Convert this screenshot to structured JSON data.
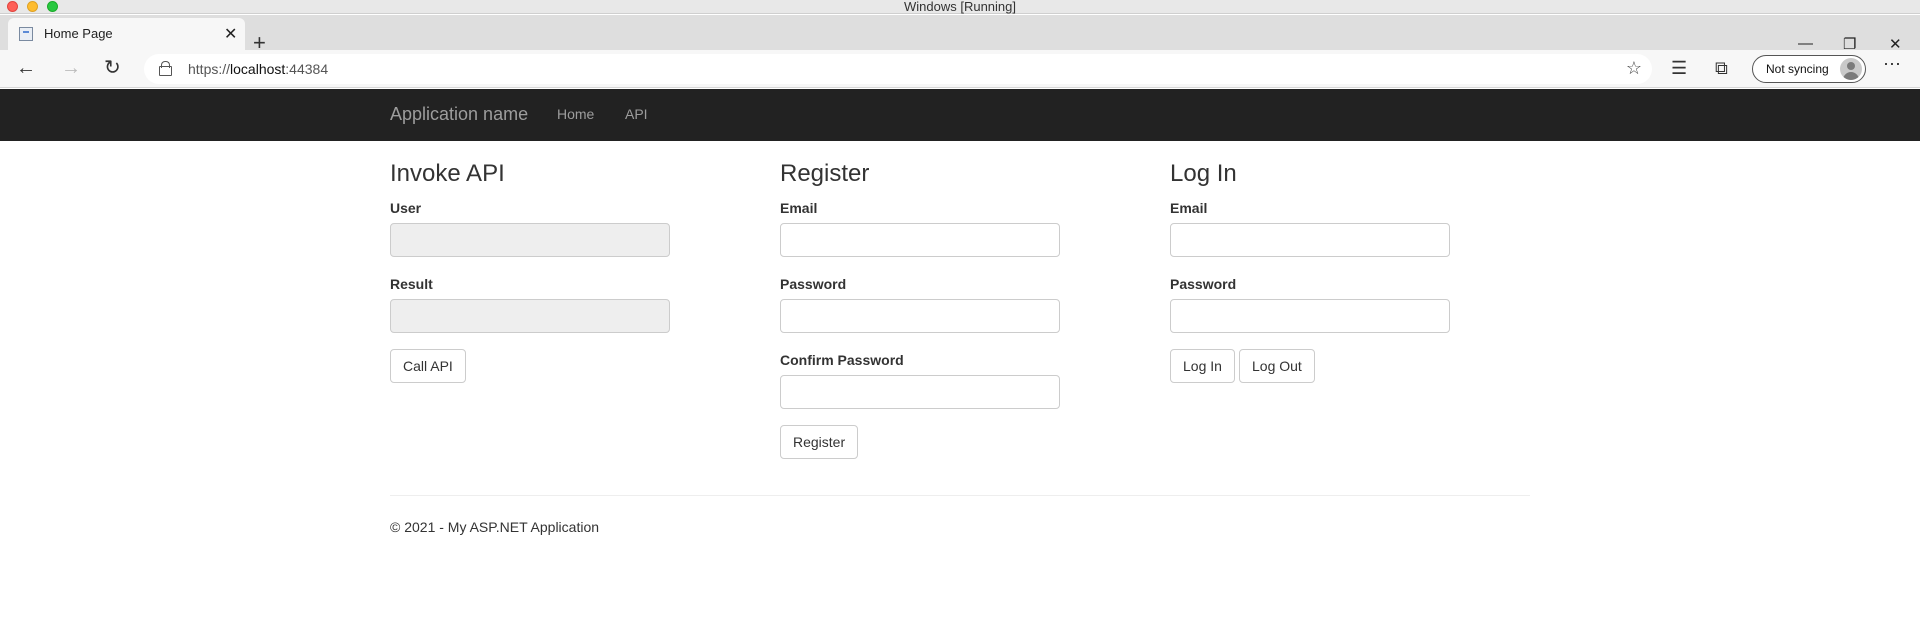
{
  "window": {
    "title": "Windows [Running]"
  },
  "browser": {
    "tab_title": "Home Page",
    "url_scheme": "https://",
    "url_host": "localhost",
    "url_port": ":44384",
    "sync_label": "Not syncing"
  },
  "navbar": {
    "brand": "Application name",
    "links": [
      "Home",
      "API"
    ]
  },
  "invoke_api": {
    "heading": "Invoke API",
    "user_label": "User",
    "user_value": "",
    "result_label": "Result",
    "result_value": "",
    "button": "Call API"
  },
  "register": {
    "heading": "Register",
    "email_label": "Email",
    "password_label": "Password",
    "confirm_label": "Confirm Password",
    "button": "Register"
  },
  "login": {
    "heading": "Log In",
    "email_label": "Email",
    "password_label": "Password",
    "login_button": "Log In",
    "logout_button": "Log Out"
  },
  "footer": {
    "text": "© 2021 - My ASP.NET Application"
  },
  "colors": {
    "navbar_bg": "#222222",
    "navbar_text": "#9d9d9d",
    "readonly_bg": "#eeeeee"
  }
}
